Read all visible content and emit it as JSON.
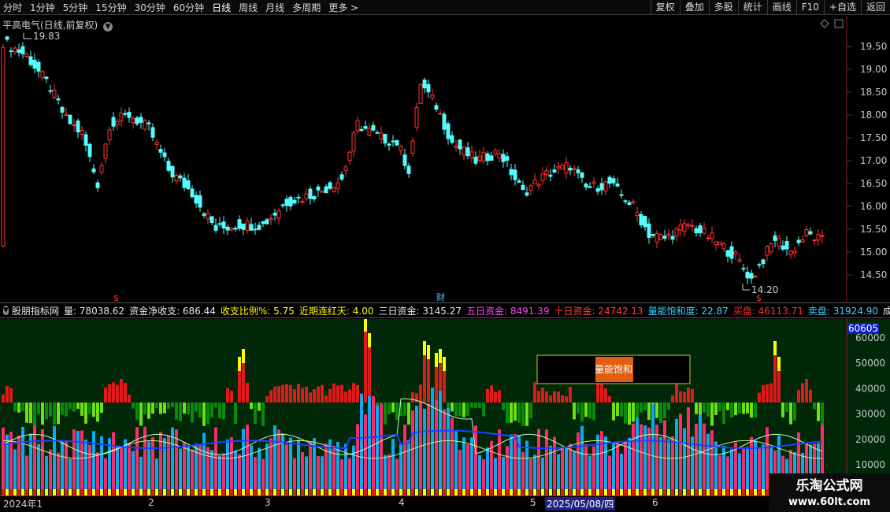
{
  "toolbar": {
    "left": [
      "分时",
      "1分钟",
      "5分钟",
      "15分钟",
      "30分钟",
      "60分钟",
      "日线",
      "周线",
      "月线",
      "多周期",
      "更多 >"
    ],
    "active": "日线",
    "right": [
      "复权",
      "叠加",
      "多股",
      "统计",
      "画线",
      "F10",
      "+自选",
      "返回"
    ]
  },
  "header": {
    "title": "平高电气(日线,前复权)"
  },
  "price_panel": {
    "y_ticks": [
      "19.50",
      "19.00",
      "18.50",
      "18.00",
      "17.50",
      "17.00",
      "16.50",
      "16.00",
      "15.50",
      "15.00",
      "14.50"
    ],
    "high_label": "19.83",
    "low_label": "14.20",
    "markers": {
      "dividend": "$",
      "report": "财"
    }
  },
  "indicator_bar": {
    "name": "股朋指标网",
    "items": [
      {
        "text": "量: 78038.62",
        "color": "#e8e8e8"
      },
      {
        "text": "资金净收支: 686.44",
        "color": "#e8e8e8"
      },
      {
        "text": "收支比例%: 5.75",
        "color": "#ffff00"
      },
      {
        "text": "近期连红天: 4.00",
        "color": "#ffff00"
      },
      {
        "text": "三日资金: 3145.27",
        "color": "#e8e8e8"
      },
      {
        "text": "五日资金: 8491.39",
        "color": "#ff40ff"
      },
      {
        "text": "十日资金: 24742.13",
        "color": "#ff4040"
      },
      {
        "text": "量能饱和度: 22.87",
        "color": "#40d0ff"
      },
      {
        "text": "买盘: 46113.71",
        "color": "#ff3030"
      },
      {
        "text": "卖盘: 31924.90",
        "color": "#40d0ff"
      },
      {
        "text": "成交",
        "color": "#e8e8e8"
      }
    ]
  },
  "volume_panel": {
    "y_ticks": [
      "60000",
      "50000",
      "40000",
      "30000",
      "20000",
      "10000"
    ],
    "current_value": "60605",
    "legend_label": "量能饱和"
  },
  "date_axis": {
    "labels": [
      "2024年1",
      "2",
      "3",
      "4",
      "5",
      "6"
    ],
    "cursor_date": "2025/05/08/四"
  },
  "watermark": {
    "main": "乐淘公式网",
    "url": "www.60lt.com"
  },
  "colors": {
    "up": "#ff3232",
    "down": "#54fcfc",
    "volume_bg": "#002808",
    "yellow": "#ffff00",
    "pink": "#ff2a6a",
    "blue_ma": "#2040ff"
  }
}
